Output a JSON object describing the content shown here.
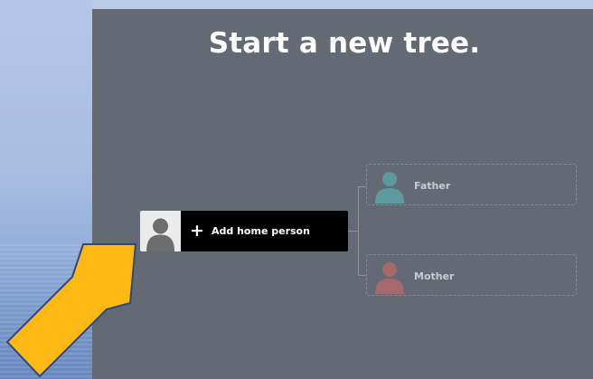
{
  "title": "Start a new tree.",
  "home_person": {
    "label": "Add home person",
    "icon": "plus-icon"
  },
  "father": {
    "label": "Father"
  },
  "mother": {
    "label": "Mother"
  },
  "colors": {
    "panel": "#646a73",
    "father_avatar": "#5d9aa0",
    "mother_avatar": "#a5686d",
    "arrow_fill": "#fdb813",
    "arrow_stroke": "#2e4a7a"
  }
}
